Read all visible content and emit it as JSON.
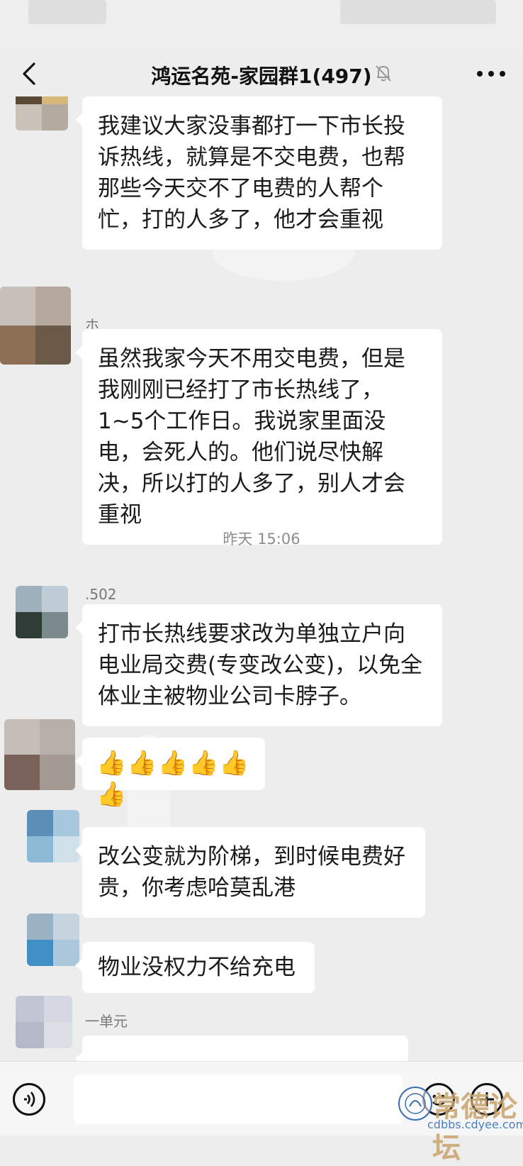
{
  "nav": {
    "title": "鸿运名苑-家园群1(497)",
    "back_icon": "chevron-left-icon",
    "mute_icon": "bell-off-icon",
    "more_icon": "more-dots-icon"
  },
  "messages": [
    {
      "nick": "",
      "text": "我建议大家没事都打一下市长投诉热线，就算是不交电费，也帮那些今天交不了电费的人帮个忙，打的人多了，他才会重视"
    },
    {
      "nick": "ホ",
      "text": "虽然我家今天不用交电费，但是我刚刚已经打了市长热线了，1~5个工作日。我说家里面没电，会死人的。他们说尽快解决，所以打的人多了，别人才会重视"
    },
    {
      "nick": ".502",
      "text": "打市长热线要求改为单独立户向电业局交费(专变改公变)，以免全体业主被物业公司卡脖子。"
    },
    {
      "nick": "",
      "text": "👍👍👍👍👍👍"
    },
    {
      "nick": "",
      "text": "改公变就为阶梯，到时候电费好贵，你考虑哈莫乱港"
    },
    {
      "nick": "",
      "text": "物业没权力不给充电"
    },
    {
      "nick": "一单元",
      "text": ""
    }
  ],
  "time_divider": "昨天 15:06",
  "input": {
    "placeholder": ""
  },
  "watermark": {
    "big": "常德论坛",
    "url": "cdbbs.cdyee.com"
  },
  "colors": {
    "background": "#ededed",
    "bubble": "#ffffff",
    "timestamp": "#8c8c8c"
  }
}
